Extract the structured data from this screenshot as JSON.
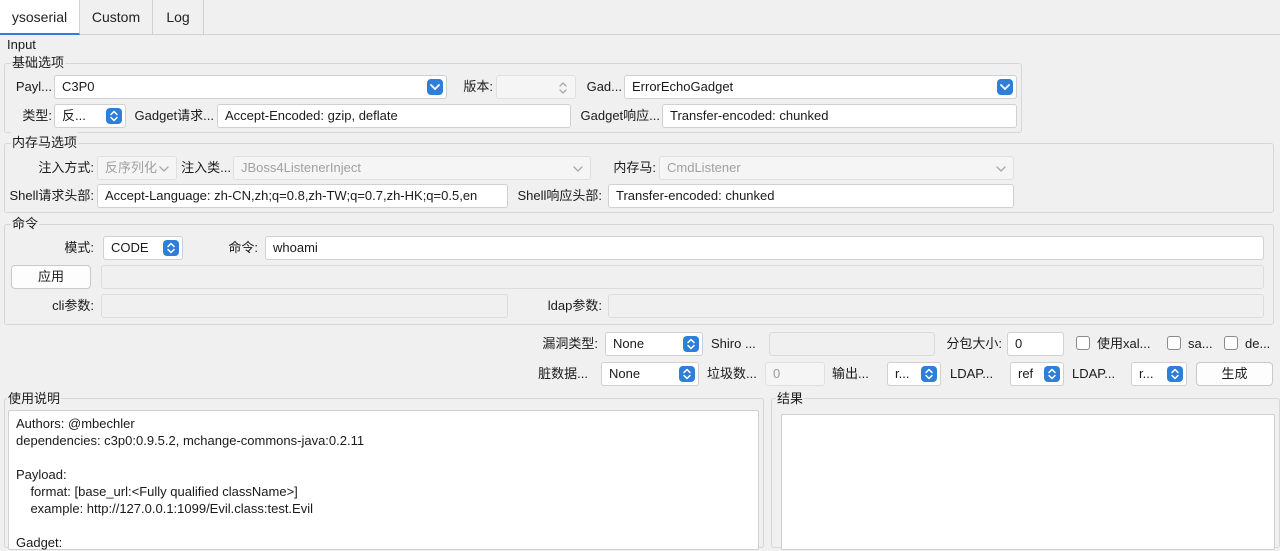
{
  "tabs": [
    "ysoserial",
    "Custom",
    "Log"
  ],
  "input_title": "Input",
  "basic": {
    "title": "基础选项",
    "payload_label": "Payl...",
    "payload_value": "C3P0",
    "version_label": "版本:",
    "version_value": "",
    "gadget_label": "Gad...",
    "gadget_value": "ErrorEchoGadget",
    "type_label": "类型:",
    "type_value": "反...",
    "gadget_req_label": "Gadget请求...",
    "gadget_req_value": "Accept-Encoded: gzip, deflate",
    "gadget_resp_label": "Gadget响应...",
    "gadget_resp_value": "Transfer-encoded: chunked"
  },
  "memshell": {
    "title": "内存马选项",
    "inject_mode_label": "注入方式:",
    "inject_mode_value": "反序列化",
    "inject_class_label": "注入类...",
    "inject_class_value": "JBoss4ListenerInject",
    "memshell_label": "内存马:",
    "memshell_value": "CmdListener",
    "shell_req_label": "Shell请求头部:",
    "shell_req_value": "Accept-Language: zh-CN,zh;q=0.8,zh-TW;q=0.7,zh-HK;q=0.5,en",
    "shell_resp_label": "Shell响应头部:",
    "shell_resp_value": "Transfer-encoded: chunked"
  },
  "command": {
    "title": "命令",
    "mode_label": "模式:",
    "mode_value": "CODE",
    "cmd_label": "命令:",
    "cmd_value": "whoami",
    "apply_label": "应用",
    "apply_output": "",
    "cli_label": "cli参数:",
    "cli_value": "",
    "ldap_label": "ldap参数:",
    "ldap_value": ""
  },
  "options": {
    "vuln_type_label": "漏洞类型:",
    "vuln_type_value": "None",
    "shiro_label": "Shiro ...",
    "shiro_value": "",
    "chunk_label": "分包大小:",
    "chunk_value": "0",
    "xalan_label": "使用xal...",
    "sa_label": "sa...",
    "de_label": "de...",
    "dirty_label": "脏数据...",
    "dirty_value": "None",
    "junk_label": "垃圾数...",
    "junk_value": "0",
    "output_label": "输出...",
    "output_value": "r...",
    "ldap1_label": "LDAP...",
    "ldap1_value": "ref",
    "ldap2_label": "LDAP...",
    "ldap2_value": "r...",
    "generate_label": "生成"
  },
  "usage": {
    "title": "使用说明",
    "text": "Authors: @mbechler\ndependencies: c3p0:0.9.5.2, mchange-commons-java:0.2.11\n\nPayload:\n    format: [base_url:<Fully qualified className>]\n    example: http://127.0.0.1:1099/Evil.class:test.Evil\n\nGadget:"
  },
  "result": {
    "title": "结果",
    "text": ""
  },
  "colors": {
    "accent": "#2f7fd8",
    "background": "#f0f0f0"
  },
  "icons": {
    "combo_arrow": "chevron-down-icon",
    "spinner_arrow": "up-down-chevron-icon"
  }
}
